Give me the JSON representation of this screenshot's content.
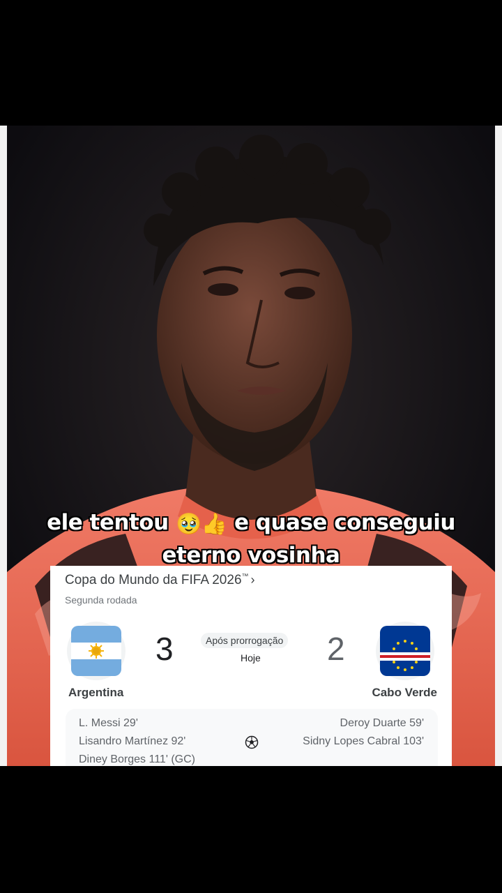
{
  "caption": {
    "line1_before": "ele tentou",
    "emoji1": "🥹",
    "emoji2": "👍",
    "line1_after": "e quase conseguiu",
    "line2": "eterno vosinha"
  },
  "match_card": {
    "competition": "Copa do Mundo da FIFA 2026",
    "trademark": "™",
    "round": "Segunda rodada",
    "status": "Após prorrogação",
    "date": "Hoje",
    "home": {
      "name": "Argentina",
      "score": "3",
      "flag_icon": "argentina-flag-icon",
      "scorers": [
        "L. Messi 29'",
        "Lisandro Martínez 92'",
        "Diney Borges 111' (GC)"
      ]
    },
    "away": {
      "name": "Cabo Verde",
      "score": "2",
      "flag_icon": "cape-verde-flag-icon",
      "scorers": [
        "Deroy Duarte 59'",
        "Sidny Lopes Cabral 103'"
      ]
    },
    "goal_icon": "soccer-ball-icon"
  },
  "colors": {
    "shirt": "#e8735e",
    "background": "#16131a",
    "argentina_blue": "#74acdf",
    "cape_verde_blue": "#003893",
    "cape_verde_red": "#cf2027"
  }
}
